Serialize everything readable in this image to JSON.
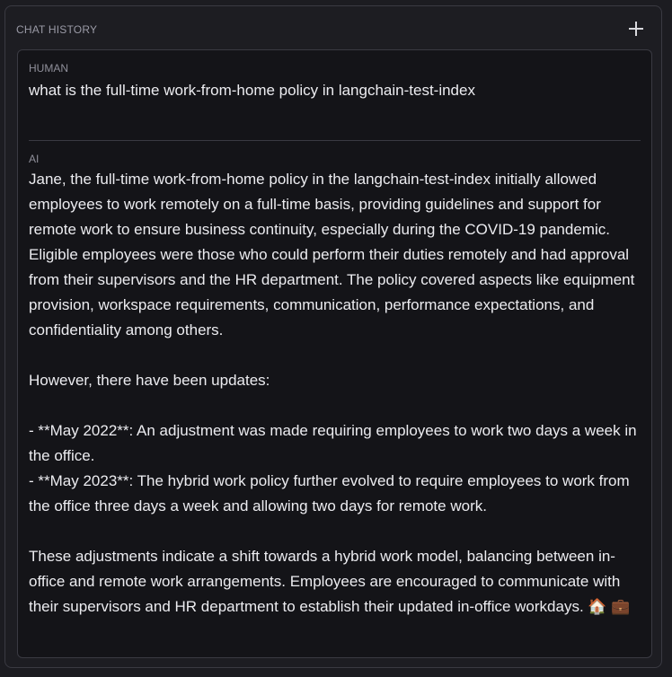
{
  "panel": {
    "title": "CHAT HISTORY",
    "add_icon": "plus-icon"
  },
  "human": {
    "role": "HUMAN",
    "text": "what is the full-time work-from-home policy in langchain-test-index"
  },
  "ai": {
    "role": "AI",
    "paragraphs": [
      "Jane, the full-time work-from-home policy in the langchain-test-index initially allowed employees to work remotely on a full-time basis, providing guidelines and support for remote work to ensure business continuity, especially during the COVID-19 pandemic. Eligible employees were those who could perform their duties remotely and had approval from their supervisors and the HR department. The policy covered aspects like equipment provision, workspace requirements, communication, performance expectations, and confidentiality among others.",
      "However, there have been updates:",
      "- **May 2022**: An adjustment was made requiring employees to work two days a week in the office.",
      "- **May 2023**: The hybrid work policy further evolved to require employees to work from the office three days a week and allowing two days for remote work.",
      "These adjustments indicate a shift towards a hybrid work model, balancing between in-office and remote work arrangements. Employees are encouraged to communicate with their supervisors and HR department to establish their updated in-office workdays. 🏠 💼"
    ]
  }
}
